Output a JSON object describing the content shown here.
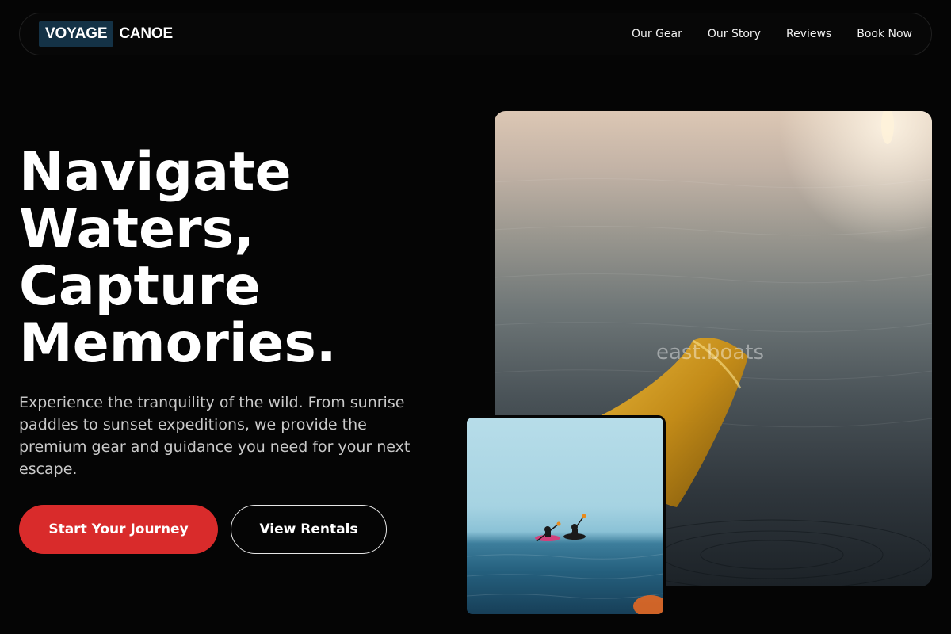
{
  "brand": {
    "logo_box_text": "VOYAGE",
    "logo_text": "CANOE"
  },
  "nav": {
    "items": [
      "Our Gear",
      "Our Story",
      "Reviews",
      "Book Now"
    ]
  },
  "hero": {
    "title_lines": [
      "Navigate",
      "Waters,",
      "Capture",
      "Memories."
    ],
    "description": "Experience the tranquility of the wild. From sunrise paddles to sunset expeditions, we provide the premium gear and guidance you need for your next escape.",
    "primary_button": "Start Your Journey",
    "secondary_button": "View Rentals"
  },
  "images": {
    "main_watermark": "east.boats"
  },
  "colors": {
    "accent": "#d92b2b",
    "logo_box": "#143246",
    "background": "#050505"
  }
}
